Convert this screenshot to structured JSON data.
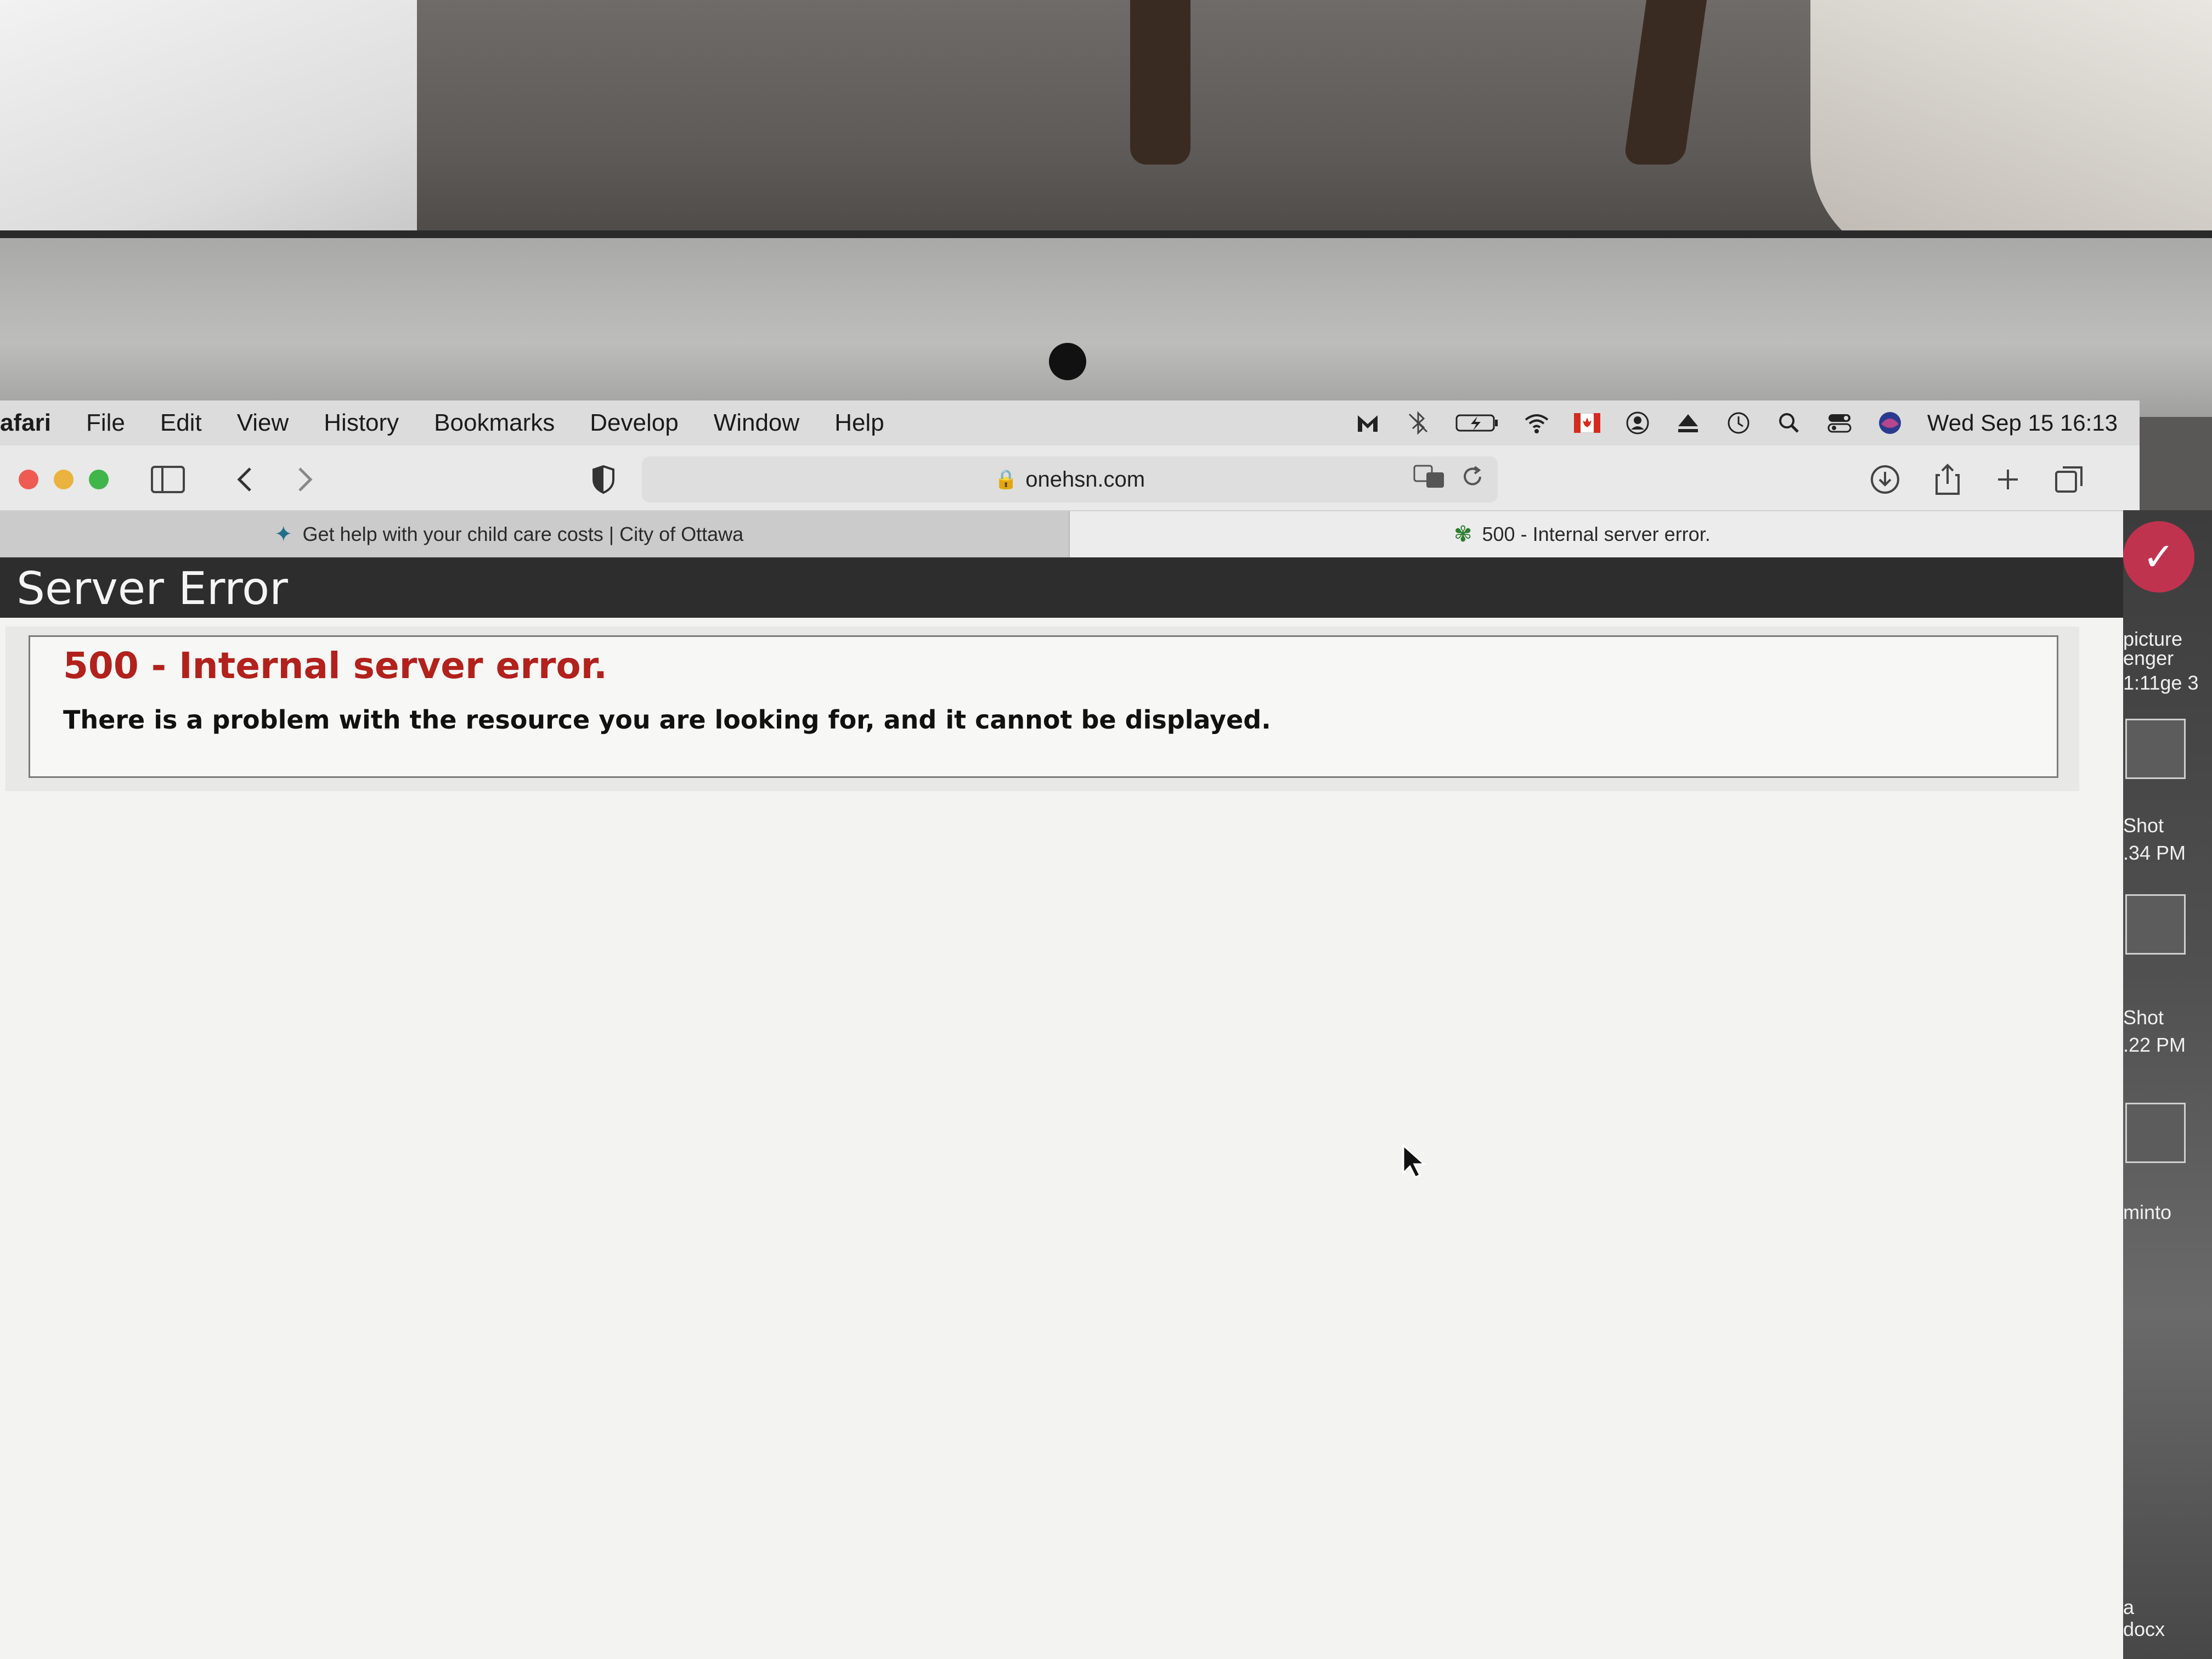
{
  "menubar": {
    "app": "afari",
    "items": [
      "File",
      "Edit",
      "View",
      "History",
      "Bookmarks",
      "Develop",
      "Window",
      "Help"
    ],
    "clock": "Wed Sep 15  16:13",
    "status_icons": [
      "malwarebytes-icon",
      "bluetooth-off-icon",
      "battery-charging-icon",
      "wifi-icon",
      "canada-flag-icon",
      "user-icon",
      "eject-icon",
      "time-machine-icon",
      "spotlight-search-icon",
      "control-center-icon",
      "siri-icon"
    ]
  },
  "toolbar": {
    "url": "onehsn.com"
  },
  "tabs": [
    {
      "title": "Get help with your child care costs | City of Ottawa",
      "active": false
    },
    {
      "title": "500 - Internal server error.",
      "active": true
    }
  ],
  "page": {
    "header": "Server Error",
    "error_title": "500 - Internal server error.",
    "error_message": "There is a problem with the resource you are looking for, and it cannot be displayed."
  },
  "desktop_edge": {
    "labels": [
      "picture",
      "enger",
      "1:11ge 3",
      "Shot",
      ".34 PM",
      "Shot",
      ".22 PM",
      "minto",
      "a",
      "docx"
    ]
  },
  "colors": {
    "error_red": "#b2211c",
    "header_bg": "#2d2d2d"
  }
}
